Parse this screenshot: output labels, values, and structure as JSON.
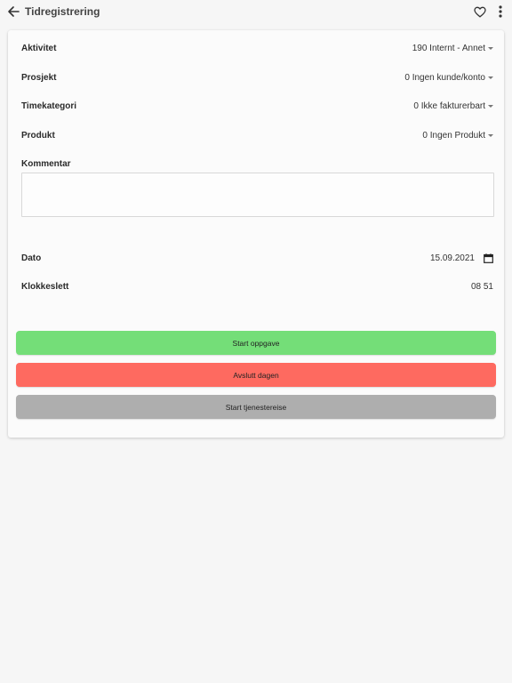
{
  "header": {
    "title": "Tidregistrering",
    "back_icon": "arrow-left-icon",
    "favorite_icon": "heart-outline-icon",
    "menu_icon": "more-vertical-icon"
  },
  "form": {
    "activity": {
      "label": "Aktivitet",
      "value": "190 Internt - Annet"
    },
    "project": {
      "label": "Prosjekt",
      "value": "0 Ingen kunde/konto"
    },
    "hour_category": {
      "label": "Timekategori",
      "value": "0 Ikke fakturerbart"
    },
    "product": {
      "label": "Produkt",
      "value": "0 Ingen Produkt"
    },
    "comment": {
      "label": "Kommentar",
      "value": ""
    },
    "date": {
      "label": "Dato",
      "value": "15.09.2021"
    },
    "time": {
      "label": "Klokkeslett",
      "value": "08 51"
    }
  },
  "buttons": {
    "start_task": {
      "label": "Start oppgave",
      "color": "#74de78"
    },
    "end_day": {
      "label": "Avslutt dagen",
      "color": "#fe6a60"
    },
    "start_trip": {
      "label": "Start tjenestereise",
      "color": "#aeaeae"
    }
  }
}
